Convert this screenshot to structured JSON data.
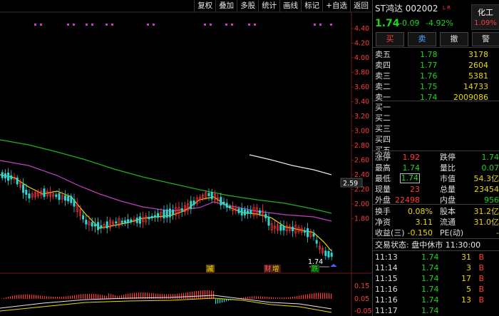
{
  "toolbar": {
    "items": [
      "复权",
      "叠加",
      "多股",
      "统计",
      "画线",
      "标记",
      "+自选",
      "返回"
    ]
  },
  "chart": {
    "price_axis": [
      "4.40",
      "4.20",
      "4.00",
      "3.80",
      "3.60",
      "3.40",
      "3.20",
      "3.00",
      "2.80",
      "2.60",
      "2.40",
      "2.20",
      "2.00",
      "1.80"
    ],
    "cursor_price": "2.59",
    "last_price_label": "1.74",
    "indicator_axis": [
      "0.15",
      "0.05",
      "-0.05"
    ],
    "markers": [
      "减",
      "财",
      "增",
      "跌"
    ],
    "colors": {
      "ma_white": "#e8e8e8",
      "ma_yellow": "#e8d800",
      "ma_magenta": "#c040c0",
      "ma_green": "#1fb21f",
      "up": "#ff3b3b",
      "down": "#2fd8d8"
    }
  },
  "quote": {
    "name": "ST鸿达 002002",
    "tags": "L R",
    "badge_title": "化工",
    "badge_value": "1.09%",
    "price": "1.74",
    "change": "-0.09",
    "change_pct": "-4.92%",
    "buttons": [
      "买",
      "卖",
      "撤",
      "警"
    ],
    "sells": [
      {
        "label": "卖五",
        "price": "1.78",
        "vol": "3178"
      },
      {
        "label": "卖四",
        "price": "1.77",
        "vol": "2604"
      },
      {
        "label": "卖三",
        "price": "1.76",
        "vol": "5381"
      },
      {
        "label": "卖二",
        "price": "1.75",
        "vol": "14733"
      },
      {
        "label": "卖一",
        "price": "1.74",
        "vol": "2009086"
      }
    ],
    "buys": [
      "买一",
      "买二",
      "买三",
      "买四",
      "买五"
    ],
    "stats": [
      {
        "l1": "涨停",
        "v1": "1.92",
        "l2": "跌停",
        "v2": "1.74"
      },
      {
        "l1": "最高",
        "v1": "1.74",
        "l2": "量比",
        "v2": "0.07"
      },
      {
        "l1": "最低",
        "v1": "1.74",
        "l2": "市值",
        "v2": "54.3亿"
      },
      {
        "l1": "现量",
        "v1": "23",
        "l2": "总量",
        "v2": "23454"
      },
      {
        "l1": "外盘",
        "v1": "22498",
        "l2": "内盘",
        "v2": "956"
      }
    ],
    "fund": [
      {
        "l1": "换手",
        "v1": "0.08%",
        "l2": "股本",
        "v2": "31.2亿"
      },
      {
        "l1": "净资",
        "v1": "3.11",
        "l2": "流通",
        "v2": "31.0亿"
      },
      {
        "l1": "收益(三)",
        "v1": "-0.150",
        "l2": "PE(动)",
        "v2": "-"
      }
    ],
    "trade_status": "交易状态: 盘中休市 11:30:00",
    "ticks": [
      {
        "time": "11:13",
        "price": "1.74",
        "vol": "31",
        "side": "B"
      },
      {
        "time": "11:14",
        "price": "1.74",
        "vol": "3",
        "side": "B"
      },
      {
        "time": "11:15",
        "price": "1.74",
        "vol": "17",
        "side": "B"
      },
      {
        "time": "11:16",
        "price": "1.74",
        "vol": "5",
        "side": "B"
      },
      {
        "time": "11:16",
        "price": "1.74",
        "vol": "13",
        "side": "B"
      },
      {
        "time": "11:17",
        "price": "1.74",
        "vol": "",
        "side": ""
      }
    ]
  }
}
